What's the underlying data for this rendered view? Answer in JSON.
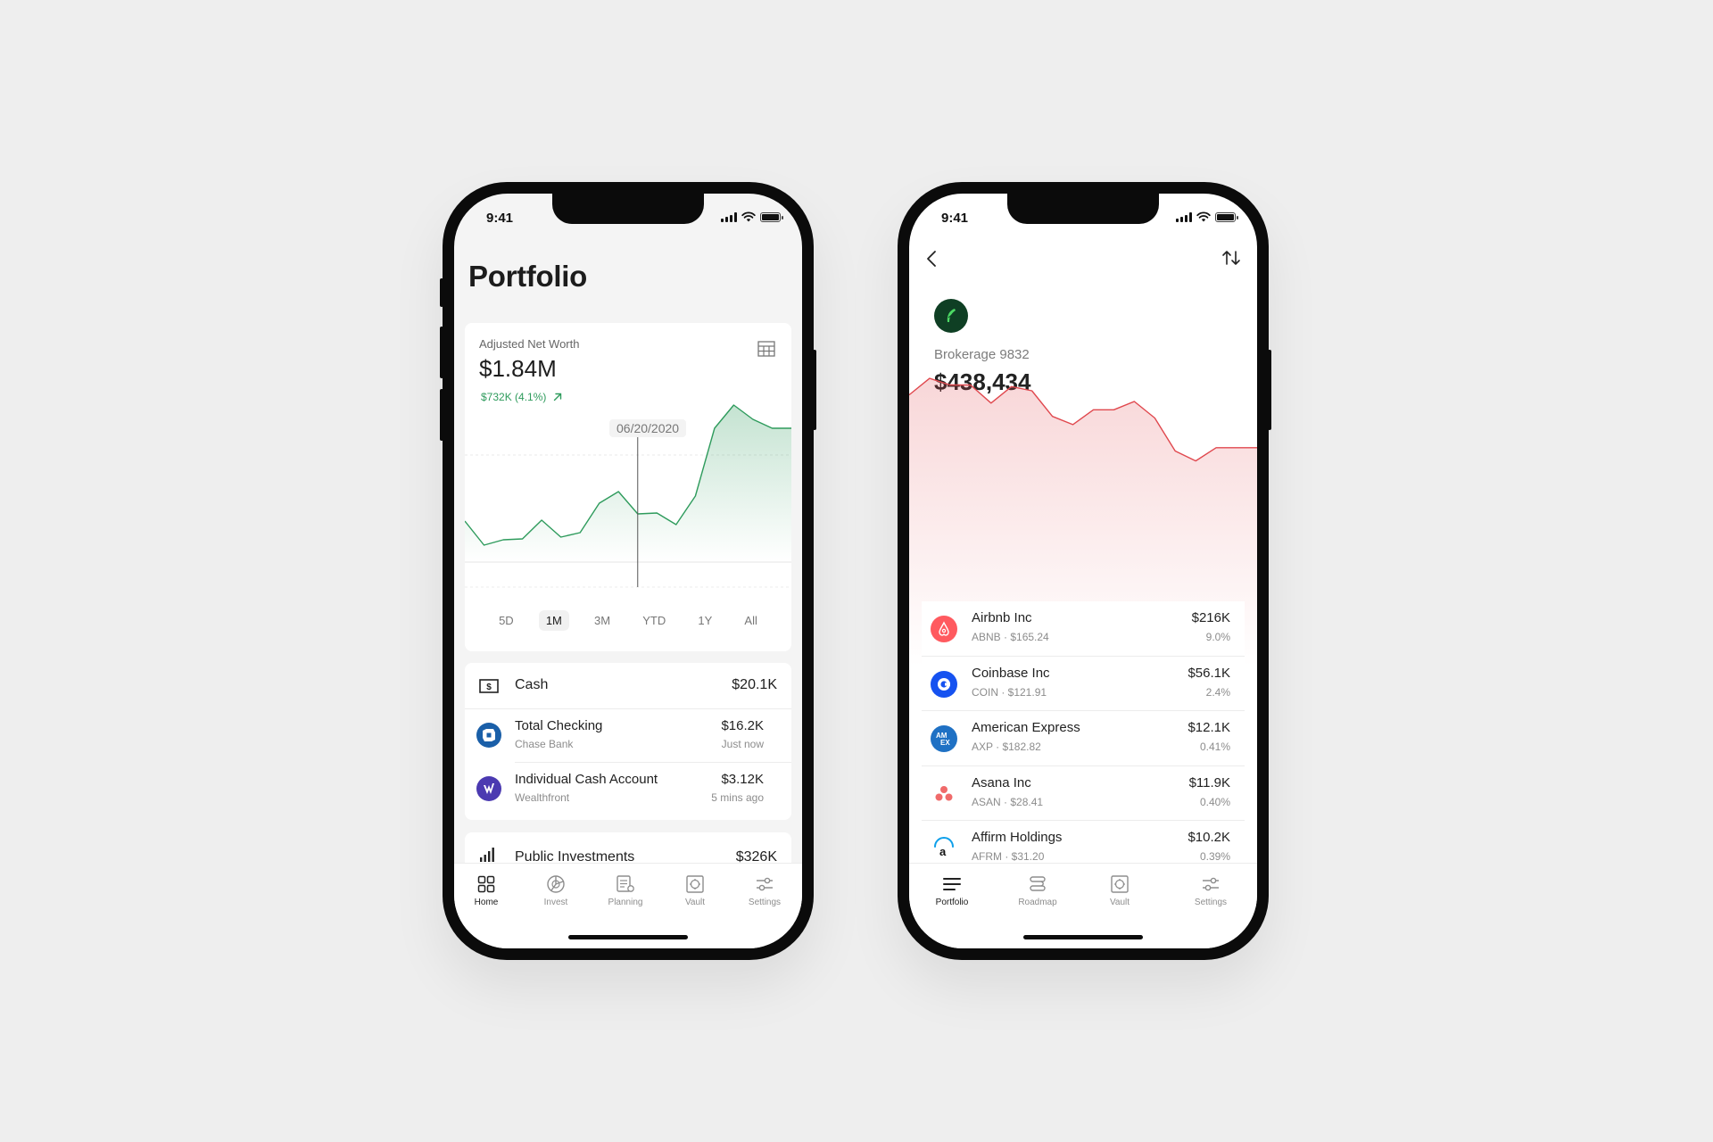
{
  "colors": {
    "positive": "#2e9b5c",
    "negative": "#e0484e",
    "background": "#eeeeee"
  },
  "left_phone": {
    "status_time": "9:41",
    "title": "Portfolio",
    "net_worth": {
      "label": "Adjusted Net Worth",
      "value": "$1.84M",
      "change": "$732K (4.1%)",
      "change_icon": "arrow-up-right-icon",
      "tooltip_date": "06/20/2020",
      "range_tabs": [
        "5D",
        "1M",
        "3M",
        "YTD",
        "1Y",
        "All"
      ],
      "active_range": "1M"
    },
    "chart_data": {
      "type": "area",
      "title": "",
      "xlabel": "",
      "ylabel": "",
      "x": [
        1,
        2,
        3,
        4,
        5,
        6,
        7,
        8,
        9,
        10,
        11,
        12,
        13,
        14,
        15,
        16,
        17,
        18
      ],
      "series": [
        {
          "values": [
            46,
            19,
            25,
            26,
            47,
            28,
            33,
            66,
            79,
            54,
            55,
            42,
            74,
            150,
            176,
            160,
            150,
            150
          ]
        }
      ],
      "ylim": [
        0,
        200
      ],
      "grid": false,
      "cursor_index": 9
    },
    "cash": {
      "icon": "cash-icon",
      "title": "Cash",
      "total": "$20.1K",
      "accounts": [
        {
          "name": "Total Checking",
          "institution": "Chase Bank",
          "amount": "$16.2K",
          "updated": "Just now",
          "icon": "chase-logo-icon"
        },
        {
          "name": "Individual Cash Account",
          "institution": "Wealthfront",
          "amount": "$3.12K",
          "updated": "5 mins ago",
          "icon": "wealthfront-logo-icon"
        }
      ]
    },
    "public_investments": {
      "icon": "bar-chart-icon",
      "title": "Public Investments",
      "total": "$326K"
    },
    "tabbar": [
      {
        "label": "Home",
        "icon": "grid-icon"
      },
      {
        "label": "Invest",
        "icon": "pie-chart-icon"
      },
      {
        "label": "Planning",
        "icon": "planning-icon"
      },
      {
        "label": "Vault",
        "icon": "vault-icon"
      },
      {
        "label": "Settings",
        "icon": "sliders-icon"
      }
    ]
  },
  "right_phone": {
    "status_time": "9:41",
    "account": {
      "logo": "robinhood-logo-icon",
      "name": "Brokerage 9832",
      "value": "$438,434"
    },
    "chart_data": {
      "type": "area",
      "title": "",
      "xlabel": "",
      "ylabel": "",
      "x": [
        1,
        2,
        3,
        4,
        5,
        6,
        7,
        8,
        9,
        10,
        11,
        12,
        13,
        14,
        15,
        16,
        17,
        18
      ],
      "series": [
        {
          "values": [
            128,
            148,
            140,
            140,
            118,
            138,
            133,
            102,
            92,
            110,
            110,
            120,
            100,
            60,
            48,
            64,
            64,
            64
          ]
        }
      ],
      "ylim": [
        0,
        160
      ],
      "grid": false
    },
    "holdings": [
      {
        "name": "Airbnb Inc",
        "detail": "ABNB · $165.24",
        "value": "$216K",
        "percent": "9.0%",
        "icon": "airbnb-logo-icon"
      },
      {
        "name": "Coinbase Inc",
        "detail": "COIN · $121.91",
        "value": "$56.1K",
        "percent": "2.4%",
        "icon": "coinbase-logo-icon"
      },
      {
        "name": "American Express",
        "detail": "AXP · $182.82",
        "value": "$12.1K",
        "percent": "0.41%",
        "icon": "amex-logo-icon"
      },
      {
        "name": "Asana Inc",
        "detail": "ASAN · $28.41",
        "value": "$11.9K",
        "percent": "0.40%",
        "icon": "asana-logo-icon"
      },
      {
        "name": "Affirm Holdings",
        "detail": "AFRM · $31.20",
        "value": "$10.2K",
        "percent": "0.39%",
        "icon": "affirm-logo-icon"
      }
    ],
    "tabbar": [
      {
        "label": "Portfolio",
        "icon": "list-icon"
      },
      {
        "label": "Roadmap",
        "icon": "roadmap-icon"
      },
      {
        "label": "Vault",
        "icon": "vault-icon"
      },
      {
        "label": "Settings",
        "icon": "sliders-icon"
      }
    ]
  }
}
